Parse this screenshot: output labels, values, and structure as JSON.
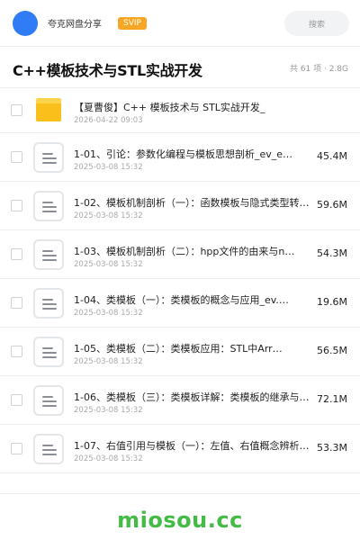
{
  "topbar": {
    "share_label": "夸克网盘分享",
    "badge": "SVIP",
    "search_placeholder": "搜索"
  },
  "header": {
    "title": "C++模板技术与STL实战开发",
    "meta": "共 61 项 · 2.8G"
  },
  "files": [
    {
      "type": "folder",
      "name": "【夏曹俊】C++ 模板技术与 STL实战开发_",
      "date": "2026-04-22 09:03",
      "size": ""
    },
    {
      "type": "file",
      "name": "1-01、引论：参数化编程与模板思想剖析_ev_e…",
      "date": "2025-03-08 15:32",
      "size": "45.4M"
    },
    {
      "type": "file",
      "name": "1-02、模板机制剖析（一）：函数模板与隐式类型转…",
      "date": "2025-03-08 15:32",
      "size": "59.6M"
    },
    {
      "type": "file",
      "name": "1-03、模板机制剖析（二）：hpp文件的由来与n…",
      "date": "2025-03-08 15:32",
      "size": "54.3M"
    },
    {
      "type": "file",
      "name": "1-04、类模板（一）：类模板的概念与应用_ev.…",
      "date": "2025-03-08 15:32",
      "size": "19.6M"
    },
    {
      "type": "file",
      "name": "1-05、类模板（二）：类模板应用：STL中Arr…",
      "date": "2025-03-08 15:32",
      "size": "56.5M"
    },
    {
      "type": "file",
      "name": "1-06、类模板（三）：类模板详解：类模板的继承与…",
      "date": "2025-03-08 15:32",
      "size": "72.1M"
    },
    {
      "type": "file",
      "name": "1-07、右值引用与模板（一）：左值、右值概念辨析…",
      "date": "2025-03-08 15:32",
      "size": "53.3M"
    }
  ],
  "footer": {
    "brand": "miosou.cc"
  },
  "colors": {
    "accent_blue": "#2f7cf6",
    "svip_orange": "#f5a623",
    "folder_yellow": "#fbbf1b",
    "brand_green": "#44bb44"
  },
  "icons": {
    "folder": "folder-icon",
    "file": "document-icon"
  }
}
